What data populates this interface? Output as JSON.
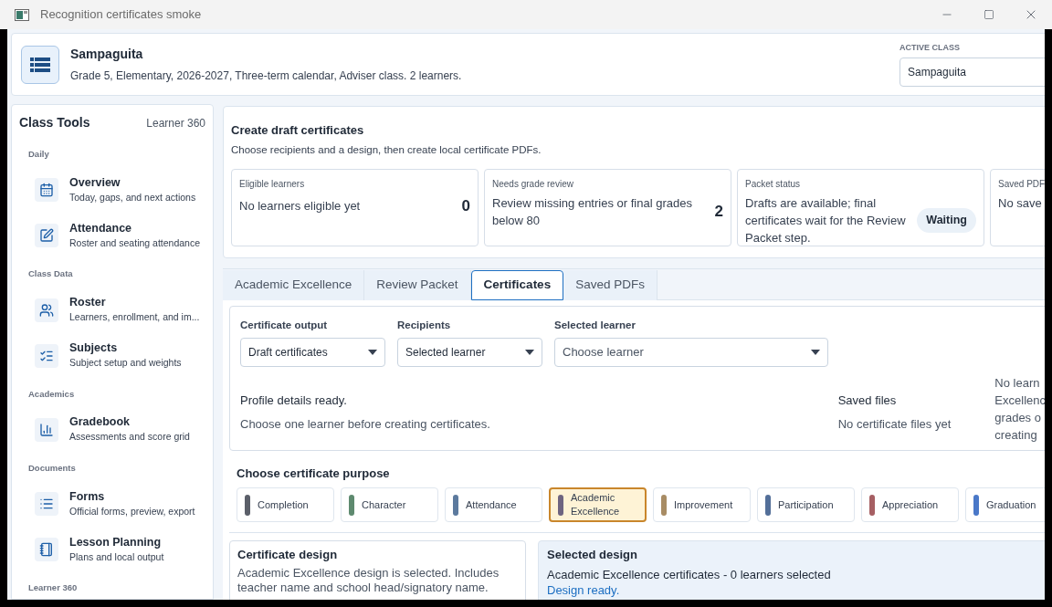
{
  "window": {
    "title": "Recognition certificates smoke"
  },
  "header": {
    "title": "Sampaguita",
    "subtitle": "Grade 5, Elementary, 2026-2027, Three-term calendar, Adviser class. 2 learners.",
    "active_class_label": "ACTIVE CLASS",
    "active_class_value": "Sampaguita"
  },
  "sidebar": {
    "title": "Class Tools",
    "link": "Learner 360",
    "sections": [
      {
        "label": "Daily",
        "items": [
          {
            "title": "Overview",
            "subtitle": "Today, gaps, and next actions"
          },
          {
            "title": "Attendance",
            "subtitle": "Roster and seating attendance"
          }
        ]
      },
      {
        "label": "Class Data",
        "items": [
          {
            "title": "Roster",
            "subtitle": "Learners, enrollment, and im..."
          },
          {
            "title": "Subjects",
            "subtitle": "Subject setup and weights"
          }
        ]
      },
      {
        "label": "Academics",
        "items": [
          {
            "title": "Gradebook",
            "subtitle": "Assessments and score grid"
          }
        ]
      },
      {
        "label": "Documents",
        "items": [
          {
            "title": "Forms",
            "subtitle": "Official forms, preview, export"
          },
          {
            "title": "Lesson Planning",
            "subtitle": "Plans and local output"
          }
        ]
      },
      {
        "label": "Learner 360"
      }
    ]
  },
  "summary": {
    "title": "Create draft certificates",
    "subtitle": "Choose recipients and a design, then create local certificate PDFs.",
    "cards": [
      {
        "label": "Eligible learners",
        "text": "No learners eligible yet",
        "value": "0"
      },
      {
        "label": "Needs grade review",
        "text": "Review missing entries or final grades below 80",
        "value": "2"
      },
      {
        "label": "Packet status",
        "text": "Drafts are available; final certificates wait for the Review Packet step.",
        "badge": "Waiting"
      },
      {
        "label": "Saved PDF",
        "text": "No save"
      }
    ]
  },
  "tabs": [
    {
      "label": "Academic Excellence",
      "selected": false
    },
    {
      "label": "Review Packet",
      "selected": false
    },
    {
      "label": "Certificates",
      "selected": true
    },
    {
      "label": "Saved PDFs",
      "selected": false
    }
  ],
  "form": {
    "fields": [
      {
        "label": "Certificate output",
        "value": "Draft certificates"
      },
      {
        "label": "Recipients",
        "value": "Selected learner"
      },
      {
        "label": "Selected learner",
        "placeholder": "Choose learner"
      }
    ],
    "status_title": "Profile details ready.",
    "status_text": "Choose one learner before creating certificates.",
    "files_title": "Saved files",
    "files_text": "No certificate files yet",
    "note_lines": [
      "No learn",
      "Excellenc",
      "grades o",
      "creating"
    ]
  },
  "purpose": {
    "title": "Choose certificate purpose",
    "options": [
      {
        "label": "Completion",
        "color": "#5b5f69",
        "selected": false
      },
      {
        "label": "Character",
        "color": "#5e8a6f",
        "selected": false
      },
      {
        "label": "Attendance",
        "color": "#5c7a9e",
        "selected": false
      },
      {
        "label": "Academic Excellence",
        "color": "#6e6480",
        "selected": true
      },
      {
        "label": "Improvement",
        "color": "#a88c64",
        "selected": false
      },
      {
        "label": "Participation",
        "color": "#536f99",
        "selected": false
      },
      {
        "label": "Appreciation",
        "color": "#a65f63",
        "selected": false
      },
      {
        "label": "Graduation",
        "color": "#4a78c8",
        "selected": false
      }
    ]
  },
  "design": {
    "title": "Certificate design",
    "text": "Academic Excellence design is selected. Includes teacher name and school head/signatory name."
  },
  "selected_design": {
    "title": "Selected design",
    "text": "Academic Excellence certificates - 0 learners selected",
    "status": "Design ready."
  }
}
